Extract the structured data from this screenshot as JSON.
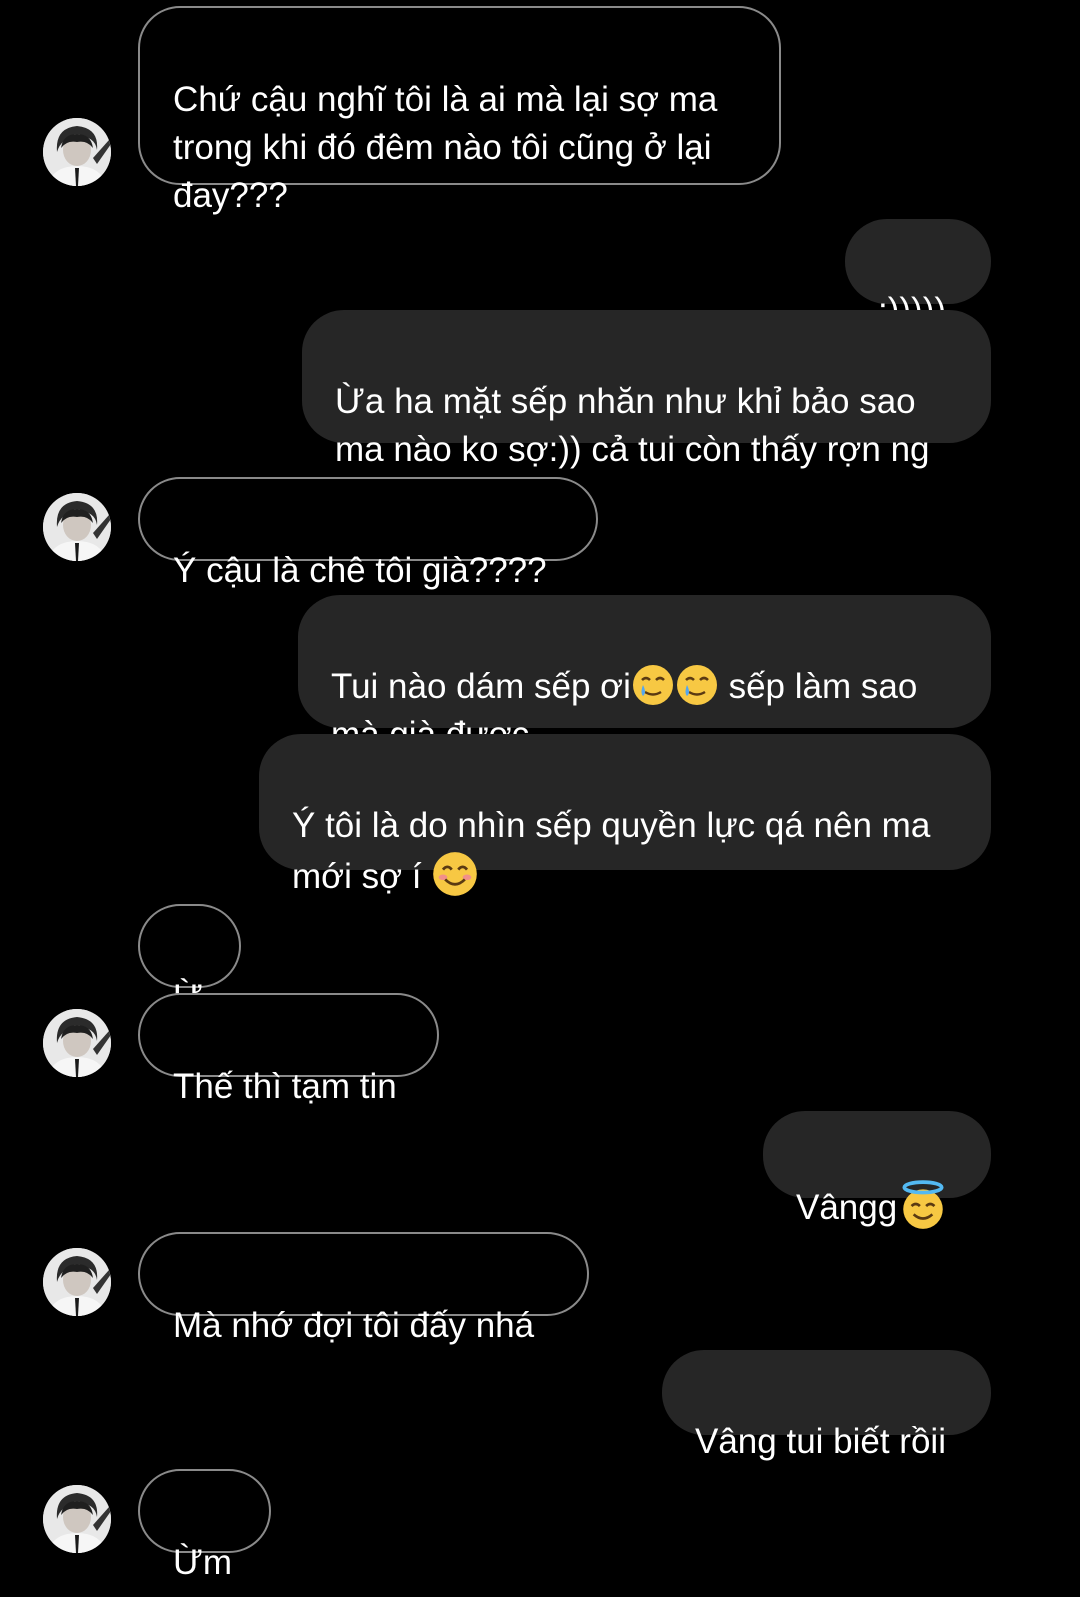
{
  "messages": [
    {
      "from": "them",
      "text": "Chứ cậu nghĩ tôi là ai mà lại sợ ma\ntrong khi đó đêm nào tôi cũng ở lại\nđay???"
    },
    {
      "from": "me",
      "text": ":)))))"
    },
    {
      "from": "me",
      "text": "Ừa ha mặt sếp nhăn như khỉ bảo sao\nma nào ko sợ:)) cả tui còn thấy rợn ng"
    },
    {
      "from": "them",
      "text": "Ý cậu là chê tôi già????"
    },
    {
      "from": "me",
      "text_a": "Tui nào dám sếp ơi",
      "text_b": " sếp làm sao\nmà già được",
      "emoji": "smiling-face-with-tear"
    },
    {
      "from": "me",
      "text": "Ý tôi là do nhìn sếp quyền lực qá nên ma\nmới sợ í ",
      "emoji": "smiling-face-with-smiling-eyes"
    },
    {
      "from": "them",
      "text": "Ừ"
    },
    {
      "from": "them",
      "text": "Thế thì tạm tin"
    },
    {
      "from": "me",
      "text": "Vângg",
      "emoji": "smiling-face-with-halo"
    },
    {
      "from": "them",
      "text": "Mà nhớ đợi tôi đấy nhá"
    },
    {
      "from": "me",
      "text": "Vâng tui biết rồii"
    },
    {
      "from": "them",
      "text": "Ừm"
    }
  ],
  "colors": {
    "background": "#000000",
    "outgoing_bubble": "#262626",
    "incoming_border": "#8a8a8a",
    "text": "#ffffff"
  },
  "avatar": {
    "icon": "contact-avatar"
  }
}
